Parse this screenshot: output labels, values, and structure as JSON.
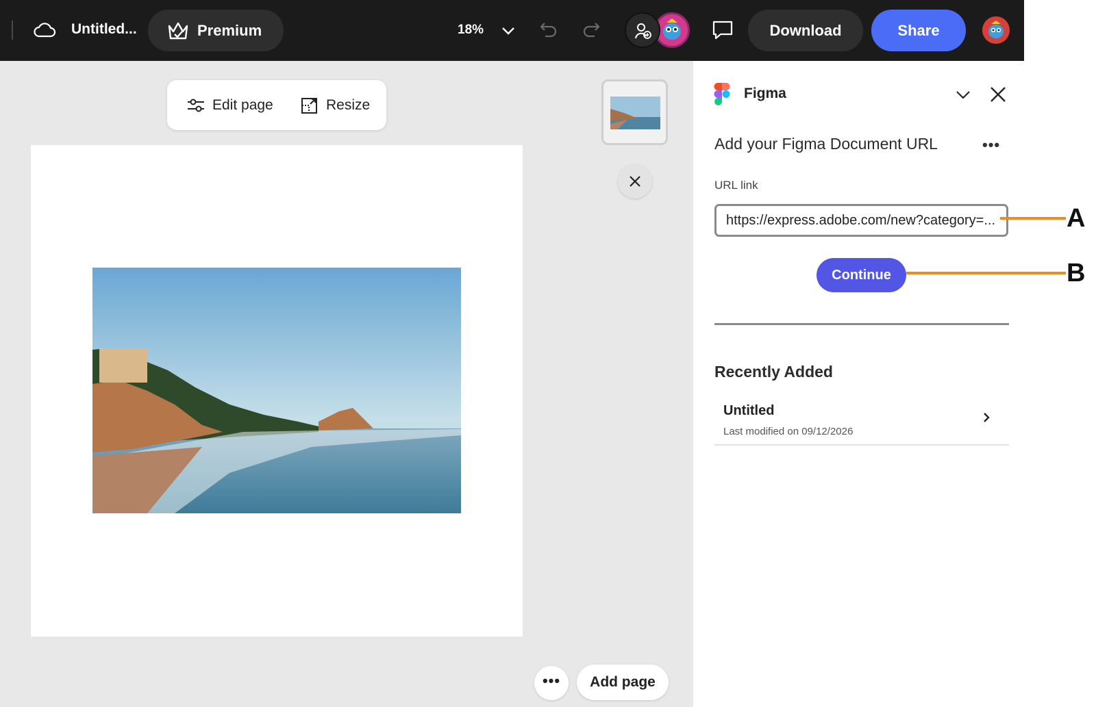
{
  "topbar": {
    "doc_title": "Untitled...",
    "premium_label": "Premium",
    "zoom": "18%",
    "download_label": "Download",
    "share_label": "Share"
  },
  "page_toolbar": {
    "edit_label": "Edit page",
    "resize_label": "Resize"
  },
  "canvas": {
    "add_page_label": "Add page",
    "more_label": "•••"
  },
  "panel": {
    "app_name": "Figma",
    "heading": "Add your Figma Document URL",
    "menu_dots": "•••",
    "url_label": "URL link",
    "url_value": "https://express.adobe.com/new?category=...",
    "continue_label": "Continue",
    "recent_heading": "Recently Added",
    "recent_items": [
      {
        "title": "Untitled",
        "subtitle": "Last modified on 09/12/2026"
      }
    ]
  },
  "callouts": {
    "a": "A",
    "b": "B"
  },
  "colors": {
    "topbar_bg": "#1b1b1b",
    "share_blue": "#4a6cf7",
    "continue_purple": "#5356e4",
    "callout_orange": "#f08c1e",
    "canvas_bg": "#e8e8e8"
  }
}
